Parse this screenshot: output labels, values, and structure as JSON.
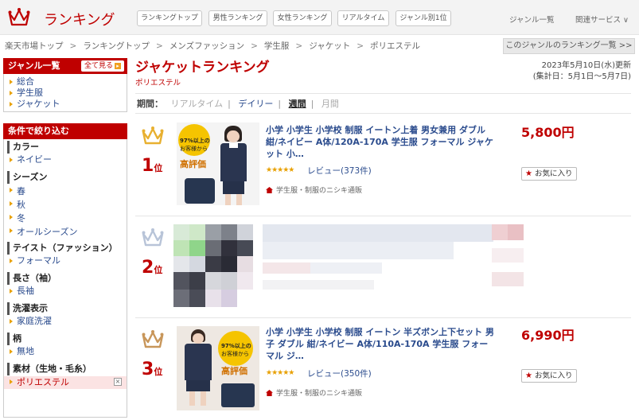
{
  "header": {
    "logo_text": "ランキング",
    "tabs": [
      "ランキングトップ",
      "男性ランキング",
      "女性ランキング",
      "リアルタイム",
      "ジャンル別1位"
    ],
    "genre_list_link": "ジャンル一覧",
    "related_services": "関連サービス ∨"
  },
  "breadcrumb": [
    "楽天市場トップ",
    "ランキングトップ",
    "メンズファッション",
    "学生服",
    "ジャケット",
    "ポリエステル"
  ],
  "breadcrumb_sep": ">",
  "genre_ranking_link": "このジャンルのランキング一覧 >>",
  "sidebar": {
    "genre_header": "ジャンル一覧",
    "see_all": "全て見る",
    "genres": [
      "総合",
      "学生服",
      "ジャケット"
    ],
    "filter_header": "条件で絞り込む",
    "filters": [
      {
        "title": "カラー",
        "items": [
          "ネイビー"
        ]
      },
      {
        "title": "シーズン",
        "items": [
          "春",
          "秋",
          "冬",
          "オールシーズン"
        ]
      },
      {
        "title": "テイスト（ファッション）",
        "items": [
          "フォーマル"
        ]
      },
      {
        "title": "長さ（袖）",
        "items": [
          "長袖"
        ]
      },
      {
        "title": "洗濯表示",
        "items": [
          "家庭洗濯"
        ]
      },
      {
        "title": "柄",
        "items": [
          "無地"
        ]
      },
      {
        "title": "素材（生地・毛糸）",
        "items": [
          "ポリエステル"
        ]
      }
    ],
    "remove_icon": "×"
  },
  "main": {
    "title": "ジャケットランキング",
    "subtitle": "ポリエステル",
    "updated": "2023年5月10日(水)更新",
    "period_range": "(集計日：5月1日～5月7日)",
    "period_label": "期間：",
    "periods": [
      "リアルタイム",
      "デイリー",
      "週間",
      "月間"
    ],
    "period_sep": "|"
  },
  "items": [
    {
      "rank": "1",
      "rank_suffix": "位",
      "title": "小学 小学生 小学校 制服 イートン上着 男女兼用 ダブル 紺/ネイビー A体/120A-170A 学生服 フォーマル ジャケット 小…",
      "stars": "★★★★★",
      "review": "レビュー(373件)",
      "shop": "学生服・制服のニシキ通販",
      "price": "5,800円",
      "fav": "お気に入り",
      "badge_line1": "97%以上の",
      "badge_line2": "お客様から",
      "badge_line3": "高評価"
    },
    {
      "rank": "2",
      "rank_suffix": "位"
    },
    {
      "rank": "3",
      "rank_suffix": "位",
      "title": "小学 小学生 小学校 制服 イートン 半ズボン上下セット 男子 ダブル 紺/ネイビー A体/110A-170A 学生服 フォーマル ジ…",
      "stars": "★★★★★",
      "review": "レビュー(350件)",
      "shop": "学生服・制服のニシキ通販",
      "price": "6,990円",
      "fav": "お気に入り",
      "badge_line1": "97%以上の",
      "badge_line2": "お客様から",
      "badge_line3": "高評価"
    }
  ],
  "colors": {
    "accent": "#bf0000",
    "link": "#2a4b8d",
    "gold": "#e8b030",
    "silver": "#b8c4d8",
    "bronze": "#c8965a"
  }
}
